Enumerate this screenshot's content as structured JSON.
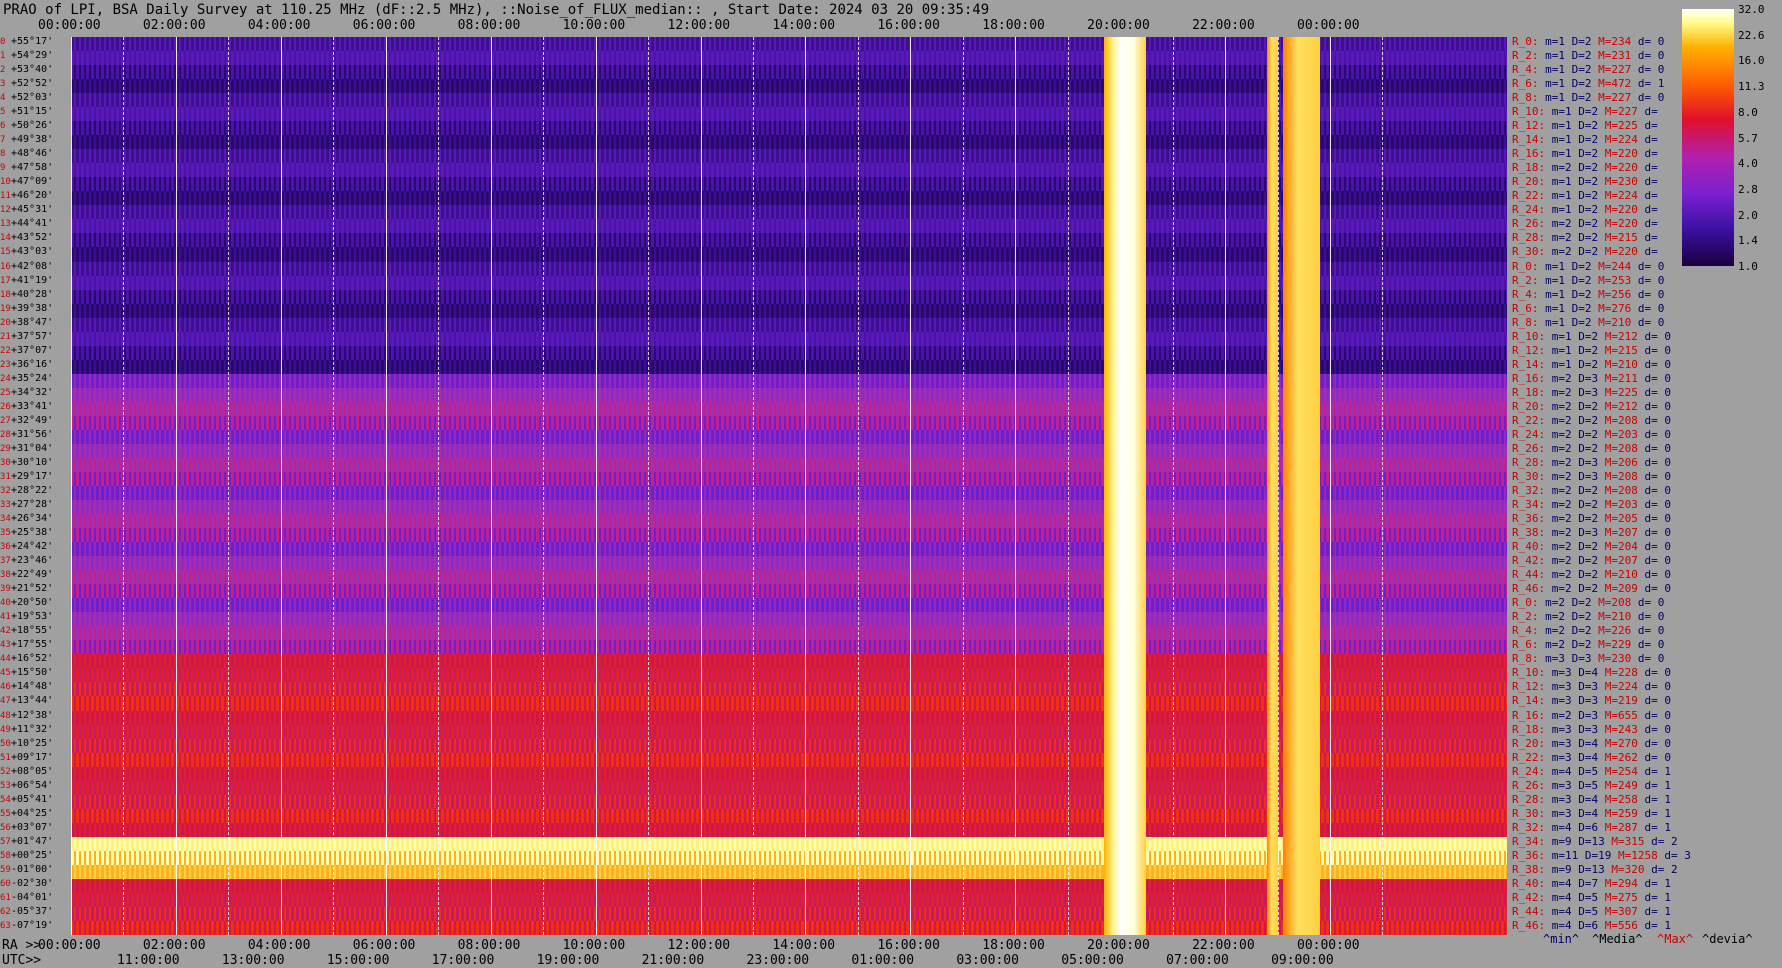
{
  "title": "PRAO of LPI, BSA Daily Survey at 110.25 MHz (dF::2.5 MHz), ::Noise_of_FLUX_median:: , Start Date: 2024 03 20 09:35:49",
  "x_top_ticks": [
    "00:00:00",
    "02:00:00",
    "04:00:00",
    "06:00:00",
    "08:00:00",
    "10:00:00",
    "12:00:00",
    "14:00:00",
    "16:00:00",
    "18:00:00",
    "20:00:00",
    "22:00:00",
    "00:00:00"
  ],
  "x_bottom_label_1": "RA >>",
  "x_bottom_ticks_1": [
    "00:00:00",
    "02:00:00",
    "04:00:00",
    "06:00:00",
    "08:00:00",
    "10:00:00",
    "12:00:00",
    "14:00:00",
    "16:00:00",
    "18:00:00",
    "20:00:00",
    "22:00:00",
    "00:00:00"
  ],
  "x_bottom_label_2": "UTC>>",
  "x_bottom_ticks_2": [
    "11:00:00",
    "13:00:00",
    "15:00:00",
    "17:00:00",
    "19:00:00",
    "21:00:00",
    "23:00:00",
    "01:00:00",
    "03:00:00",
    "05:00:00",
    "07:00:00",
    "09:00:00"
  ],
  "y_ticks": [
    {
      "i": "0",
      "d": "+55°17'"
    },
    {
      "i": "1",
      "d": "+54°29'"
    },
    {
      "i": "2",
      "d": "+53°40'"
    },
    {
      "i": "3",
      "d": "+52°52'"
    },
    {
      "i": "4",
      "d": "+52°03'"
    },
    {
      "i": "5",
      "d": "+51°15'"
    },
    {
      "i": "6",
      "d": "+50°26'"
    },
    {
      "i": "7",
      "d": "+49°38'"
    },
    {
      "i": "8",
      "d": "+48°46'"
    },
    {
      "i": "9",
      "d": "+47°58'"
    },
    {
      "i": "10",
      "d": "+47°09'"
    },
    {
      "i": "11",
      "d": "+46°20'"
    },
    {
      "i": "12",
      "d": "+45°31'"
    },
    {
      "i": "13",
      "d": "+44°41'"
    },
    {
      "i": "14",
      "d": "+43°52'"
    },
    {
      "i": "15",
      "d": "+43°03'"
    },
    {
      "i": "16",
      "d": "+42°08'"
    },
    {
      "i": "17",
      "d": "+41°19'"
    },
    {
      "i": "18",
      "d": "+40°28'"
    },
    {
      "i": "19",
      "d": "+39°38'"
    },
    {
      "i": "20",
      "d": "+38°47'"
    },
    {
      "i": "21",
      "d": "+37°57'"
    },
    {
      "i": "22",
      "d": "+37°07'"
    },
    {
      "i": "23",
      "d": "+36°16'"
    },
    {
      "i": "24",
      "d": "+35°24'"
    },
    {
      "i": "25",
      "d": "+34°32'"
    },
    {
      "i": "26",
      "d": "+33°41'"
    },
    {
      "i": "27",
      "d": "+32°49'"
    },
    {
      "i": "28",
      "d": "+31°56'"
    },
    {
      "i": "29",
      "d": "+31°04'"
    },
    {
      "i": "30",
      "d": "+30°10'"
    },
    {
      "i": "31",
      "d": "+29°17'"
    },
    {
      "i": "32",
      "d": "+28°22'"
    },
    {
      "i": "33",
      "d": "+27°28'"
    },
    {
      "i": "34",
      "d": "+26°34'"
    },
    {
      "i": "35",
      "d": "+25°38'"
    },
    {
      "i": "36",
      "d": "+24°42'"
    },
    {
      "i": "37",
      "d": "+23°46'"
    },
    {
      "i": "38",
      "d": "+22°49'"
    },
    {
      "i": "39",
      "d": "+21°52'"
    },
    {
      "i": "40",
      "d": "+20°50'"
    },
    {
      "i": "41",
      "d": "+19°53'"
    },
    {
      "i": "42",
      "d": "+18°55'"
    },
    {
      "i": "43",
      "d": "+17°55'"
    },
    {
      "i": "44",
      "d": "+16°52'"
    },
    {
      "i": "45",
      "d": "+15°50'"
    },
    {
      "i": "46",
      "d": "+14°48'"
    },
    {
      "i": "47",
      "d": "+13°44'"
    },
    {
      "i": "48",
      "d": "+12°38'"
    },
    {
      "i": "49",
      "d": "+11°32'"
    },
    {
      "i": "50",
      "d": "+10°25'"
    },
    {
      "i": "51",
      "d": "+09°17'"
    },
    {
      "i": "52",
      "d": "+08°05'"
    },
    {
      "i": "53",
      "d": "+06°54'"
    },
    {
      "i": "54",
      "d": "+05°41'"
    },
    {
      "i": "55",
      "d": "+04°25'"
    },
    {
      "i": "56",
      "d": "+03°07'"
    },
    {
      "i": "57",
      "d": "+01°47'"
    },
    {
      "i": "58",
      "d": "+00°25'"
    },
    {
      "i": "59",
      "d": "-01°00'"
    },
    {
      "i": "60",
      "d": "-02°30'"
    },
    {
      "i": "61",
      "d": "-04°01'"
    },
    {
      "i": "62",
      "d": "-05°37'"
    },
    {
      "i": "63",
      "d": "-07°19'"
    }
  ],
  "stats": [
    {
      "r": "R_0:",
      "m": "1",
      "d": "2",
      "M": "234",
      "dv": "0"
    },
    {
      "r": "R_2:",
      "m": "1",
      "d": "2",
      "M": "231",
      "dv": "0"
    },
    {
      "r": "R_4:",
      "m": "1",
      "d": "2",
      "M": "227",
      "dv": "0"
    },
    {
      "r": "R_6:",
      "m": "1",
      "d": "2",
      "M": "472",
      "dv": "1"
    },
    {
      "r": "R_8:",
      "m": "1",
      "d": "2",
      "M": "227",
      "dv": "0"
    },
    {
      "r": "R_10:",
      "m": "1",
      "d": "2",
      "M": "227",
      "dv": ""
    },
    {
      "r": "R_12:",
      "m": "1",
      "d": "2",
      "M": "225",
      "dv": ""
    },
    {
      "r": "R_14:",
      "m": "1",
      "d": "2",
      "M": "224",
      "dv": ""
    },
    {
      "r": "R_16:",
      "m": "1",
      "d": "2",
      "M": "220",
      "dv": ""
    },
    {
      "r": "R_18:",
      "m": "2",
      "d": "2",
      "M": "220",
      "dv": ""
    },
    {
      "r": "R_20:",
      "m": "1",
      "d": "2",
      "M": "230",
      "dv": ""
    },
    {
      "r": "R_22:",
      "m": "1",
      "d": "2",
      "M": "224",
      "dv": ""
    },
    {
      "r": "R_24:",
      "m": "1",
      "d": "2",
      "M": "220",
      "dv": ""
    },
    {
      "r": "R_26:",
      "m": "2",
      "d": "2",
      "M": "220",
      "dv": ""
    },
    {
      "r": "R_28:",
      "m": "2",
      "d": "2",
      "M": "215",
      "dv": ""
    },
    {
      "r": "R_30:",
      "m": "2",
      "d": "2",
      "M": "220",
      "dv": ""
    },
    {
      "r": "R_0:",
      "m": "1",
      "d": "2",
      "M": "244",
      "dv": "0"
    },
    {
      "r": "R_2:",
      "m": "1",
      "d": "2",
      "M": "253",
      "dv": "0"
    },
    {
      "r": "R_4:",
      "m": "1",
      "d": "2",
      "M": "256",
      "dv": "0"
    },
    {
      "r": "R_6:",
      "m": "1",
      "d": "2",
      "M": "276",
      "dv": "0"
    },
    {
      "r": "R_8:",
      "m": "1",
      "d": "2",
      "M": "210",
      "dv": "0"
    },
    {
      "r": "R_10:",
      "m": "1",
      "d": "2",
      "M": "212",
      "dv": "0"
    },
    {
      "r": "R_12:",
      "m": "1",
      "d": "2",
      "M": "215",
      "dv": "0"
    },
    {
      "r": "R_14:",
      "m": "1",
      "d": "2",
      "M": "210",
      "dv": "0"
    },
    {
      "r": "R_16:",
      "m": "2",
      "d": "3",
      "M": "211",
      "dv": "0"
    },
    {
      "r": "R_18:",
      "m": "2",
      "d": "3",
      "M": "225",
      "dv": "0"
    },
    {
      "r": "R_20:",
      "m": "2",
      "d": "2",
      "M": "212",
      "dv": "0"
    },
    {
      "r": "R_22:",
      "m": "2",
      "d": "2",
      "M": "208",
      "dv": "0"
    },
    {
      "r": "R_24:",
      "m": "2",
      "d": "2",
      "M": "203",
      "dv": "0"
    },
    {
      "r": "R_26:",
      "m": "2",
      "d": "2",
      "M": "208",
      "dv": "0"
    },
    {
      "r": "R_28:",
      "m": "2",
      "d": "3",
      "M": "206",
      "dv": "0"
    },
    {
      "r": "R_30:",
      "m": "2",
      "d": "3",
      "M": "208",
      "dv": "0"
    },
    {
      "r": "R_32:",
      "m": "2",
      "d": "2",
      "M": "208",
      "dv": "0"
    },
    {
      "r": "R_34:",
      "m": "2",
      "d": "2",
      "M": "203",
      "dv": "0"
    },
    {
      "r": "R_36:",
      "m": "2",
      "d": "2",
      "M": "205",
      "dv": "0"
    },
    {
      "r": "R_38:",
      "m": "2",
      "d": "3",
      "M": "207",
      "dv": "0"
    },
    {
      "r": "R_40:",
      "m": "2",
      "d": "2",
      "M": "204",
      "dv": "0"
    },
    {
      "r": "R_42:",
      "m": "2",
      "d": "2",
      "M": "207",
      "dv": "0"
    },
    {
      "r": "R_44:",
      "m": "2",
      "d": "2",
      "M": "210",
      "dv": "0"
    },
    {
      "r": "R_46:",
      "m": "2",
      "d": "2",
      "M": "209",
      "dv": "0"
    },
    {
      "r": "R_0:",
      "m": "2",
      "d": "2",
      "M": "208",
      "dv": "0"
    },
    {
      "r": "R_2:",
      "m": "2",
      "d": "2",
      "M": "210",
      "dv": "0"
    },
    {
      "r": "R_4:",
      "m": "2",
      "d": "2",
      "M": "226",
      "dv": "0"
    },
    {
      "r": "R_6:",
      "m": "2",
      "d": "2",
      "M": "229",
      "dv": "0"
    },
    {
      "r": "R_8:",
      "m": "3",
      "d": "3",
      "M": "230",
      "dv": "0"
    },
    {
      "r": "R_10:",
      "m": "3",
      "d": "4",
      "M": "228",
      "dv": "0"
    },
    {
      "r": "R_12:",
      "m": "3",
      "d": "3",
      "M": "224",
      "dv": "0"
    },
    {
      "r": "R_14:",
      "m": "3",
      "d": "3",
      "M": "219",
      "dv": "0"
    },
    {
      "r": "R_16:",
      "m": "2",
      "d": "3",
      "M": "655",
      "dv": "0"
    },
    {
      "r": "R_18:",
      "m": "3",
      "d": "3",
      "M": "243",
      "dv": "0"
    },
    {
      "r": "R_20:",
      "m": "3",
      "d": "4",
      "M": "270",
      "dv": "0"
    },
    {
      "r": "R_22:",
      "m": "3",
      "d": "4",
      "M": "262",
      "dv": "0"
    },
    {
      "r": "R_24:",
      "m": "4",
      "d": "5",
      "M": "254",
      "dv": "1"
    },
    {
      "r": "R_26:",
      "m": "3",
      "d": "5",
      "M": "249",
      "dv": "1"
    },
    {
      "r": "R_28:",
      "m": "3",
      "d": "4",
      "M": "258",
      "dv": "1"
    },
    {
      "r": "R_30:",
      "m": "3",
      "d": "4",
      "M": "259",
      "dv": "1"
    },
    {
      "r": "R_32:",
      "m": "4",
      "d": "6",
      "M": "287",
      "dv": "1"
    },
    {
      "r": "R_34:",
      "m": "9",
      "d": "13",
      "M": "315",
      "dv": "2"
    },
    {
      "r": "R_36:",
      "m": "11",
      "d": "19",
      "M": "1258",
      "dv": "3"
    },
    {
      "r": "R_38:",
      "m": "9",
      "d": "13",
      "M": "320",
      "dv": "2"
    },
    {
      "r": "R_40:",
      "m": "4",
      "d": "7",
      "M": "294",
      "dv": "1"
    },
    {
      "r": "R_42:",
      "m": "4",
      "d": "5",
      "M": "275",
      "dv": "1"
    },
    {
      "r": "R_44:",
      "m": "4",
      "d": "5",
      "M": "307",
      "dv": "1"
    },
    {
      "r": "R_46:",
      "m": "4",
      "d": "6",
      "M": "556",
      "dv": "1"
    }
  ],
  "legend": [
    "^min^",
    "^Media^",
    "^Max^",
    "^devia^"
  ],
  "colorbar_ticks": [
    "32.0",
    "22.6",
    "16.0",
    "11.3",
    "8.0",
    "5.7",
    "4.0",
    "2.8",
    "2.0",
    "1.4",
    "1.0"
  ],
  "chart_data": {
    "type": "heatmap",
    "title": "PRAO of LPI, BSA Daily Survey at 110.25 MHz (dF::2.5 MHz), ::Noise_of_FLUX_median:: , Start Date: 2024 03 20 09:35:49",
    "xlabel": "RA / UTC",
    "ylabel": "",
    "colorbar_range": [
      1.0,
      32.0
    ],
    "x_hours_ra": [
      0,
      24
    ],
    "declination_range": [
      "+55°17'",
      "-07°19'"
    ],
    "bands": [
      {
        "rows": "0-23",
        "level": "low",
        "approx_value": 2.0
      },
      {
        "rows": "24-43",
        "level": "medium",
        "approx_value": 4.0
      },
      {
        "rows": "44-56",
        "level": "medium-high",
        "approx_value": 8.0
      },
      {
        "rows": "57-59",
        "level": "high",
        "approx_value": 22.6
      },
      {
        "rows": "60-63",
        "level": "medium-high",
        "approx_value": 8.0
      }
    ],
    "bright_columns_ra_hours": [
      [
        19.7,
        20.5
      ],
      [
        22.8,
        23.0
      ],
      [
        23.1,
        23.8
      ]
    ]
  }
}
